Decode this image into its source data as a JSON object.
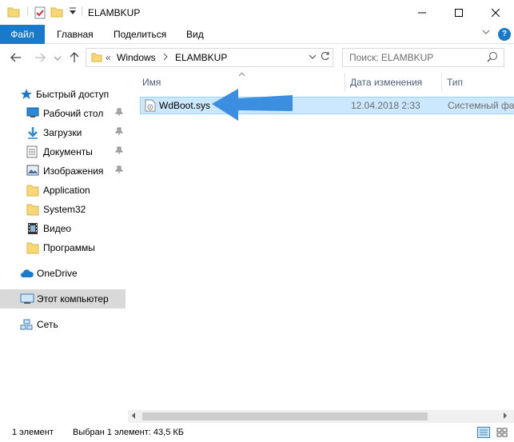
{
  "window": {
    "title": "ELAMBKUP",
    "minimize_icon": "minimize-icon",
    "maximize_icon": "maximize-icon",
    "close_icon": "close-icon"
  },
  "ribbon": {
    "tabs": [
      {
        "label": "Файл",
        "active": true
      },
      {
        "label": "Главная"
      },
      {
        "label": "Поделиться"
      },
      {
        "label": "Вид"
      }
    ],
    "help_label": "?"
  },
  "navigation": {
    "address": {
      "overflow": "«",
      "crumbs": [
        "Windows",
        "ELAMBKUP"
      ]
    },
    "search": {
      "placeholder": "Поиск: ELAMBKUP"
    }
  },
  "sidebar": {
    "quick_access": "Быстрый доступ",
    "items": [
      {
        "label": "Рабочий стол",
        "icon": "desktop-icon",
        "pinned": true
      },
      {
        "label": "Загрузки",
        "icon": "download-icon",
        "pinned": true
      },
      {
        "label": "Документы",
        "icon": "document-icon",
        "pinned": true
      },
      {
        "label": "Изображения",
        "icon": "pictures-icon",
        "pinned": true
      },
      {
        "label": "Application",
        "icon": "folder-icon",
        "pinned": false
      },
      {
        "label": "System32",
        "icon": "folder-icon",
        "pinned": false
      },
      {
        "label": "Видео",
        "icon": "video-icon",
        "pinned": false
      },
      {
        "label": "Программы",
        "icon": "folder-icon",
        "pinned": false
      }
    ],
    "onedrive": "OneDrive",
    "this_pc": "Этот компьютер",
    "network": "Сеть"
  },
  "filelist": {
    "columns": {
      "name": "Имя",
      "date": "Дата изменения",
      "type": "Тип"
    },
    "rows": [
      {
        "name": "WdBoot.sys",
        "date": "12.04.2018 2:33",
        "type": "Системный файл",
        "selected": true
      }
    ]
  },
  "status": {
    "count": "1 элемент",
    "selection": "Выбран 1 элемент: 43,5 КБ"
  },
  "colors": {
    "accent": "#1979ca",
    "selection": "#cce8ff",
    "arrow": "#3b8ee0"
  }
}
